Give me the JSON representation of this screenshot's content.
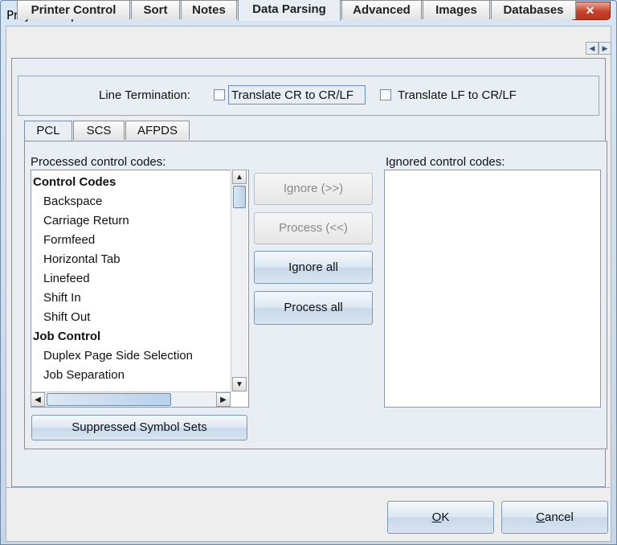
{
  "window": {
    "title": "Project Properties",
    "close_glyph": "✕"
  },
  "tabs": [
    {
      "label": "Printer Control"
    },
    {
      "label": "Sort"
    },
    {
      "label": "Notes"
    },
    {
      "label": "Data Parsing",
      "active": true
    },
    {
      "label": "Advanced"
    },
    {
      "label": "Images"
    },
    {
      "label": "Databases"
    }
  ],
  "line_termination": {
    "label": "Line Termination:",
    "option_cr": "Translate CR to CR/LF",
    "option_lf": "Translate LF to CR/LF",
    "cr_checked": false,
    "lf_checked": false
  },
  "subtabs": [
    {
      "label": "PCL",
      "active": true
    },
    {
      "label": "SCS"
    },
    {
      "label": "AFPDS"
    }
  ],
  "processed": {
    "label": "Processed control codes:",
    "items": [
      {
        "text": "Control Codes",
        "group": true
      },
      {
        "text": "Backspace"
      },
      {
        "text": "Carriage Return"
      },
      {
        "text": "Formfeed"
      },
      {
        "text": "Horizontal Tab"
      },
      {
        "text": "Linefeed"
      },
      {
        "text": "Shift In"
      },
      {
        "text": "Shift Out"
      },
      {
        "text": "Job Control",
        "group": true
      },
      {
        "text": "Duplex Page Side Selection"
      },
      {
        "text": "Job Separation"
      }
    ]
  },
  "ignored": {
    "label": "Ignored control codes:"
  },
  "actions": {
    "ignore": "Ignore (>>)",
    "process": "Process (<<)",
    "ignore_all": "Ignore all",
    "process_all": "Process all"
  },
  "suppressed_button": "Suppressed Symbol Sets",
  "footer": {
    "ok_mnemonic": "O",
    "ok_rest": "K",
    "cancel_mnemonic": "C",
    "cancel_rest": "ancel"
  },
  "colors": {
    "accent": "#6f8aa8",
    "close": "#c7402a",
    "panel": "#e8eef4"
  }
}
